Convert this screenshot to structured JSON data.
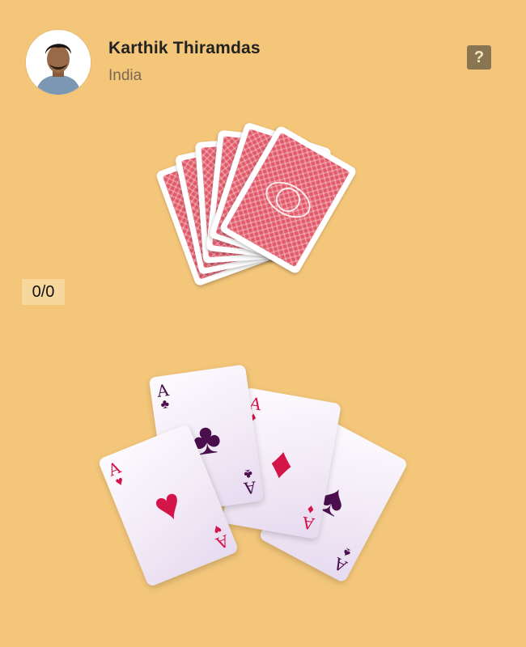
{
  "player": {
    "name": "Karthik Thiramdas",
    "country": "India"
  },
  "help": {
    "label": "?",
    "icon": "question-icon"
  },
  "score": {
    "text": "0/0"
  },
  "deck": {
    "card_back_color": "#e25a6a",
    "count": 6
  },
  "hand": [
    {
      "rank": "A",
      "suit": "clubs",
      "suit_symbol": "♣",
      "color": "purple"
    },
    {
      "rank": "A",
      "suit": "diamonds",
      "suit_symbol": "♦",
      "color": "red"
    },
    {
      "rank": "A",
      "suit": "spades",
      "suit_symbol": "♠",
      "color": "purple"
    },
    {
      "rank": "A",
      "suit": "hearts",
      "suit_symbol": "♥",
      "color": "red"
    }
  ],
  "colors": {
    "background": "#f3c67a",
    "red_suit": "#d4154a",
    "black_suit": "#4b0f4e",
    "help_button": "#8a7552"
  }
}
